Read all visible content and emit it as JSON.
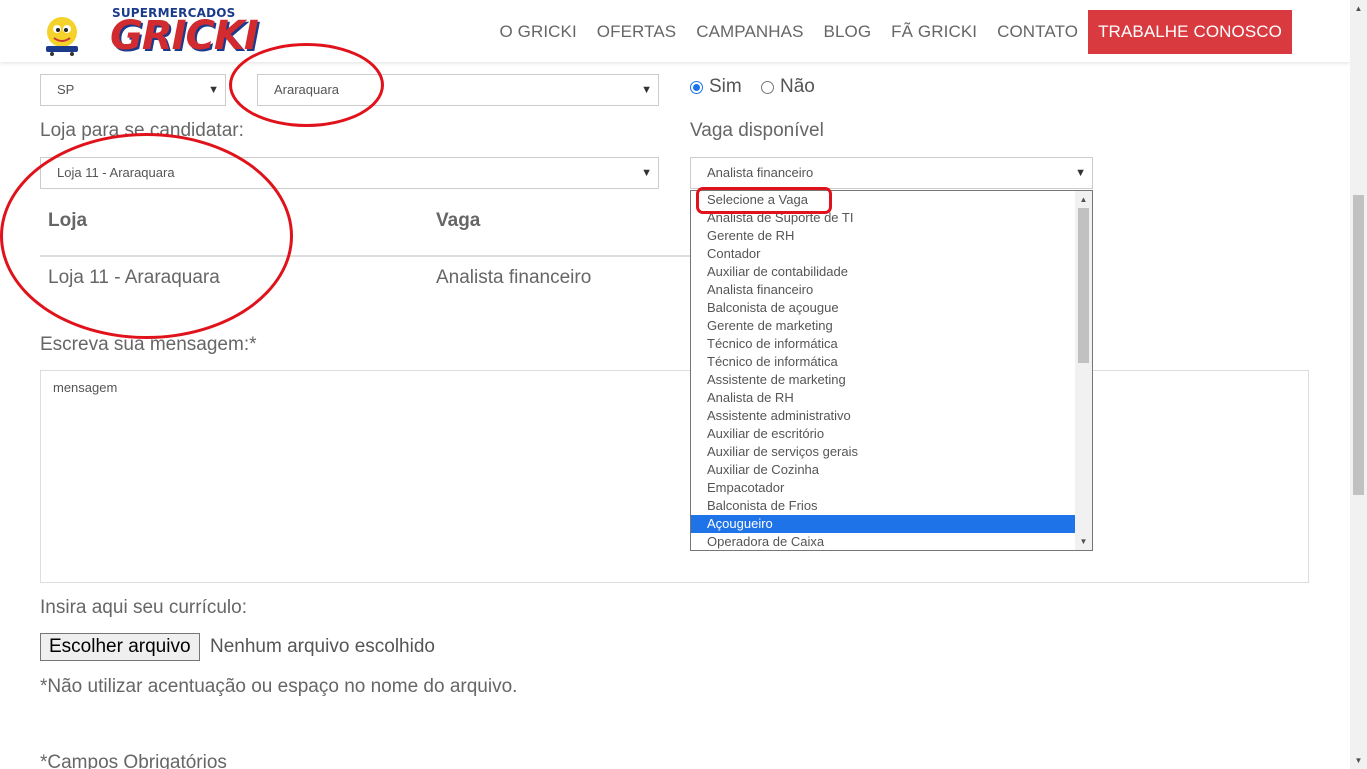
{
  "header": {
    "logo_top": "SUPERMERCADOS",
    "logo_main": "GRICKI",
    "nav": [
      "O GRICKI",
      "OFERTAS",
      "CAMPANHAS",
      "BLOG",
      "FÃ GRICKI",
      "CONTATO"
    ],
    "cta": "TRABALHE CONOSCO"
  },
  "form": {
    "state_value": "SP",
    "city_value": "Araraquara",
    "radio_yes": "Sim",
    "radio_no": "Não",
    "store_label": "Loja para se candidatar:",
    "store_value": "Loja 11 - Araraquara",
    "vacancy_label": "Vaga disponível",
    "vacancy_value": "Analista financeiro",
    "table": {
      "headers": [
        "Loja",
        "Vaga"
      ],
      "row": [
        "Loja 11 - Araraquara",
        "Analista financeiro"
      ]
    },
    "message_label": "Escreva sua mensagem:*",
    "message_placeholder": "mensagem",
    "cv_label": "Insira aqui seu currículo:",
    "file_button": "Escolher arquivo",
    "file_status": "Nenhum arquivo escolhido",
    "file_note": "*Não utilizar acentuação ou espaço no nome do arquivo.",
    "required_note": "*Campos Obrigatórios"
  },
  "vacancy_options": [
    "Selecione a Vaga",
    "Analista de Suporte de TI",
    "Gerente de RH",
    "Contador",
    "Auxiliar de contabilidade",
    "Analista financeiro",
    "Balconista de açougue",
    "Gerente de marketing",
    "Técnico de informática",
    "Técnico de informática",
    "Assistente de marketing",
    "Analista de RH",
    "Assistente administrativo",
    "Auxiliar de escritório",
    "Auxiliar de serviços gerais",
    "Auxiliar de Cozinha",
    "Empacotador",
    "Balconista de Frios",
    "Açougueiro",
    "Operadora de Caixa"
  ],
  "highlighted_option": "Açougueiro",
  "colors": {
    "accent": "#d93a3f",
    "annotation": "#e0121b",
    "selection": "#1e73e8"
  }
}
